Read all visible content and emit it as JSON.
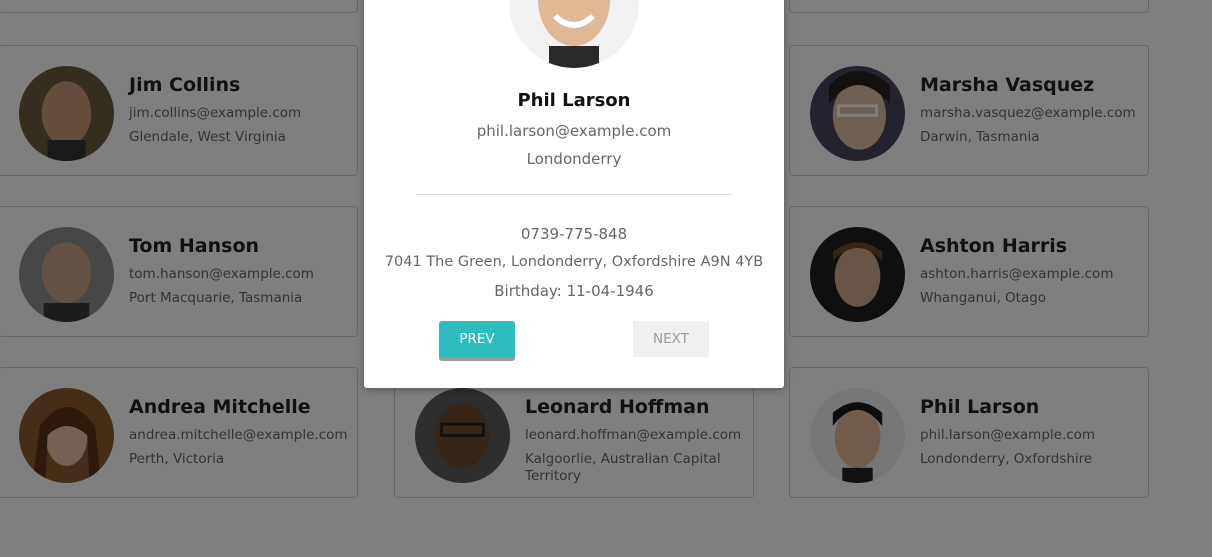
{
  "cards": [
    {
      "name": "Jim Collins",
      "email": "jim.collins@example.com",
      "location": "Glendale, West Virginia"
    },
    {
      "name": "Marsha Vasquez",
      "email": "marsha.vasquez@example.com",
      "location": "Darwin, Tasmania"
    },
    {
      "name": "Tom Hanson",
      "email": "tom.hanson@example.com",
      "location": "Port Macquarie, Tasmania"
    },
    {
      "name": "Ashton Harris",
      "email": "ashton.harris@example.com",
      "location": "Whanganui, Otago"
    },
    {
      "name": "Andrea Mitchelle",
      "email": "andrea.mitchelle@example.com",
      "location": "Perth, Victoria"
    },
    {
      "name": "Leonard Hoffman",
      "email": "leonard.hoffman@example.com",
      "location": "Kalgoorlie, Australian Capital Territory"
    },
    {
      "name": "Phil Larson",
      "email": "phil.larson@example.com",
      "location": "Londonderry, Oxfordshire"
    }
  ],
  "modal": {
    "name": "Phil Larson",
    "email": "phil.larson@example.com",
    "city": "Londonderry",
    "phone": "0739-775-848",
    "address": "7041 The Green, Londonderry, Oxfordshire A9N 4YB",
    "birthday": "Birthday: 11-04-1946",
    "prev_label": "PREV",
    "next_label": "NEXT"
  },
  "colors": {
    "accent": "#2dbdbf",
    "overlay": "rgba(0,0,0,0.5)"
  }
}
